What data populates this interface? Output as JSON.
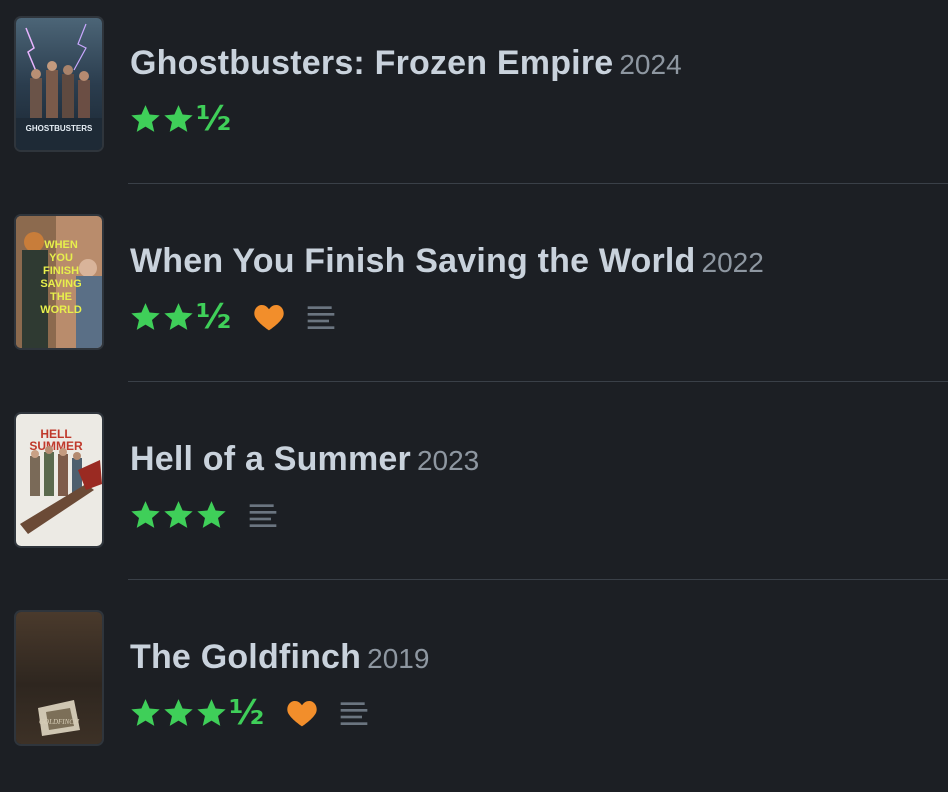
{
  "entries": [
    {
      "title": "Ghostbusters: Frozen Empire",
      "year": "2024",
      "rating_stars": 2.5,
      "half_glyph": "½",
      "liked": false,
      "has_review": false,
      "poster": {
        "name": "ghostbusters-poster",
        "caption": "GHOSTBUSTERS"
      }
    },
    {
      "title": "When You Finish Saving the World",
      "year": "2022",
      "rating_stars": 2.5,
      "half_glyph": "½",
      "liked": true,
      "has_review": true,
      "poster": {
        "name": "when-you-finish-poster",
        "caption": [
          "WHEN",
          "YOU",
          "FINISH",
          "SAVING",
          "THE",
          "WORLD"
        ]
      }
    },
    {
      "title": "Hell of a Summer",
      "year": "2023",
      "rating_stars": 3,
      "half_glyph": "",
      "liked": false,
      "has_review": true,
      "poster": {
        "name": "hell-of-a-summer-poster",
        "caption": [
          "HELL",
          "SUMMER"
        ]
      }
    },
    {
      "title": "The Goldfinch",
      "year": "2019",
      "rating_stars": 3.5,
      "half_glyph": "½",
      "liked": true,
      "has_review": true,
      "poster": {
        "name": "goldfinch-poster",
        "caption": "GOLDFINCH"
      }
    }
  ],
  "colors": {
    "background": "#1c1f24",
    "title": "#c9d2dc",
    "year": "#8e97a1",
    "star": "#3fcf59",
    "heart": "#f28e2b",
    "review_icon": "#6b7580",
    "divider": "#3a4048"
  },
  "icons": {
    "star": "star-icon",
    "heart": "heart-icon",
    "review": "review-lines-icon"
  }
}
